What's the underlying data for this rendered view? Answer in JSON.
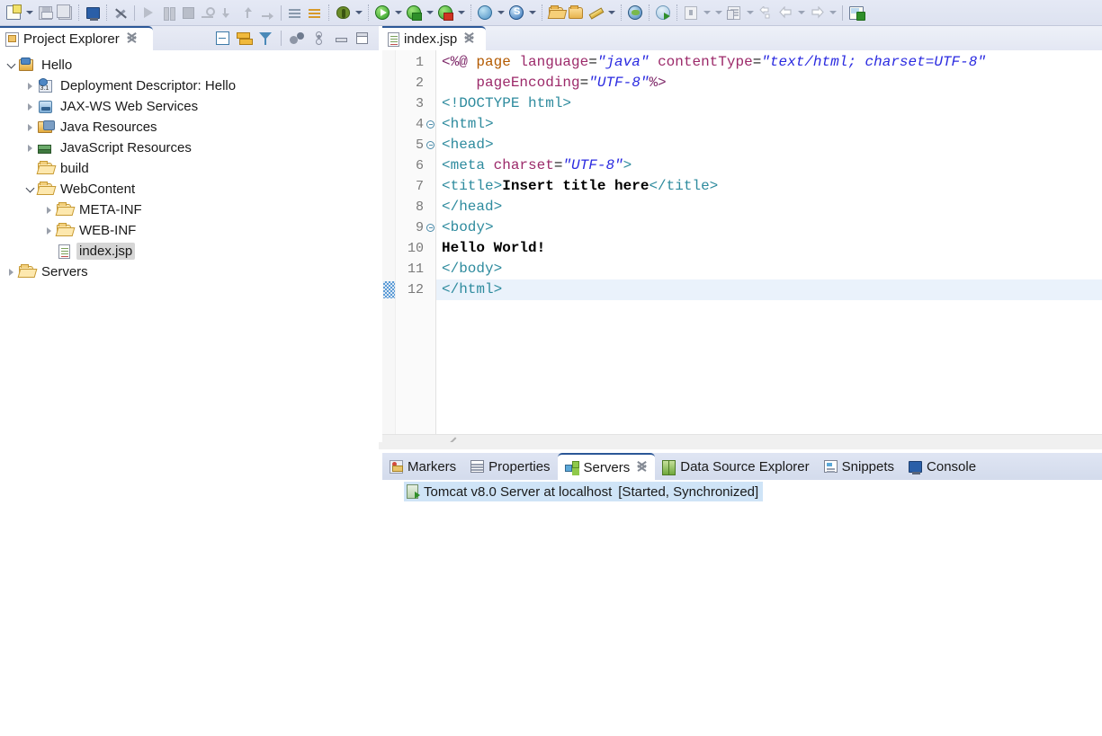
{
  "toolbar": {
    "items": [
      {
        "name": "new-wizard-icon",
        "label": "New"
      },
      {
        "name": "new-dropdown-arrow",
        "label": "New menu"
      },
      {
        "name": "save-icon",
        "label": "Save"
      },
      {
        "name": "save-all-icon",
        "label": "Save All"
      },
      {
        "name": "open-console-icon",
        "label": "Open Console"
      },
      {
        "name": "toggle-breakpoint-icon",
        "label": "Skip All Breakpoints"
      },
      {
        "name": "resume-icon",
        "label": "Resume"
      },
      {
        "name": "suspend-icon",
        "label": "Suspend"
      },
      {
        "name": "terminate-icon",
        "label": "Terminate"
      },
      {
        "name": "disconnect-icon",
        "label": "Disconnect"
      },
      {
        "name": "step-into-icon",
        "label": "Step Into"
      },
      {
        "name": "step-over-icon",
        "label": "Step Over"
      },
      {
        "name": "step-return-icon",
        "label": "Step Return"
      },
      {
        "name": "next-annotation-icon",
        "label": "Next Annotation"
      },
      {
        "name": "previous-annotation-icon",
        "label": "Previous Annotation"
      },
      {
        "name": "debug-icon",
        "label": "Debug"
      },
      {
        "name": "debug-dropdown-arrow",
        "label": "Debug menu"
      },
      {
        "name": "run-icon",
        "label": "Run"
      },
      {
        "name": "run-dropdown-arrow",
        "label": "Run menu"
      },
      {
        "name": "run-on-server-icon",
        "label": "Run on Server"
      },
      {
        "name": "run-server-dropdown-arrow",
        "label": "Run on Server menu"
      },
      {
        "name": "profile-server-icon",
        "label": "Profile on Server"
      },
      {
        "name": "profile-dropdown-arrow",
        "label": "Profile menu"
      },
      {
        "name": "new-web-project-icon",
        "label": "New Web Project"
      },
      {
        "name": "web-dropdown-arrow",
        "label": "Web menu"
      },
      {
        "name": "new-struts-icon",
        "label": "New Struts Artifact"
      },
      {
        "name": "struts-dropdown-arrow",
        "label": "Struts menu"
      },
      {
        "name": "open-type-icon",
        "label": "Open Type"
      },
      {
        "name": "open-task-icon",
        "label": "Open Task"
      },
      {
        "name": "new-java-package-icon",
        "label": "New Java Package"
      },
      {
        "name": "java-dropdown-arrow",
        "label": "Java menu"
      },
      {
        "name": "open-web-browser-icon",
        "label": "Web Browser"
      },
      {
        "name": "search-icon",
        "label": "Search"
      },
      {
        "name": "download-icon",
        "label": "Download"
      },
      {
        "name": "download-dropdown-arrow",
        "label": "Download menu"
      },
      {
        "name": "perspective-dropdown-arrow",
        "label": "Perspective menu"
      },
      {
        "name": "back-icon",
        "label": "Back"
      },
      {
        "name": "back-dropdown-arrow",
        "label": "Back menu"
      },
      {
        "name": "previous-edit-icon",
        "label": "Previous Edit Location"
      },
      {
        "name": "forward-icon",
        "label": "Forward"
      },
      {
        "name": "forward-dropdown-arrow",
        "label": "Forward menu"
      },
      {
        "name": "open-perspective-icon",
        "label": "Open Perspective"
      }
    ]
  },
  "project_explorer": {
    "title": "Project Explorer",
    "view_toolbar": [
      {
        "name": "collapse-all-icon",
        "label": "Collapse All"
      },
      {
        "name": "link-with-editor-icon",
        "label": "Link with Editor"
      },
      {
        "name": "filter-icon",
        "label": "Filters"
      },
      {
        "name": "customize-icon",
        "label": "Customize View"
      },
      {
        "name": "view-menu-icon",
        "label": "View Menu"
      },
      {
        "name": "minimize-icon",
        "label": "Minimize"
      },
      {
        "name": "maximize-icon",
        "label": "Maximize"
      }
    ],
    "tree": [
      {
        "label": "Hello",
        "indent": 0,
        "twisty": "down",
        "icon": "project-icon",
        "selected": false
      },
      {
        "label": "Deployment Descriptor: Hello",
        "indent": 1,
        "twisty": "right",
        "icon": "deployment-descriptor-icon",
        "selected": false
      },
      {
        "label": "JAX-WS Web Services",
        "indent": 1,
        "twisty": "right",
        "icon": "web-services-icon",
        "selected": false
      },
      {
        "label": "Java Resources",
        "indent": 1,
        "twisty": "right",
        "icon": "java-resources-icon",
        "selected": false
      },
      {
        "label": "JavaScript Resources",
        "indent": 1,
        "twisty": "right",
        "icon": "javascript-resources-icon",
        "selected": false
      },
      {
        "label": "build",
        "indent": 1,
        "twisty": "none",
        "icon": "folder-icon",
        "selected": false
      },
      {
        "label": "WebContent",
        "indent": 1,
        "twisty": "down",
        "icon": "folder-icon",
        "selected": false
      },
      {
        "label": "META-INF",
        "indent": 2,
        "twisty": "right",
        "icon": "folder-icon",
        "selected": false
      },
      {
        "label": "WEB-INF",
        "indent": 2,
        "twisty": "right",
        "icon": "folder-icon",
        "selected": false
      },
      {
        "label": "index.jsp",
        "indent": 2,
        "twisty": "none",
        "icon": "jsp-file-icon",
        "selected": true
      },
      {
        "label": "Servers",
        "indent": 0,
        "twisty": "right",
        "icon": "folder-icon",
        "selected": false
      }
    ]
  },
  "editor": {
    "tab_label": "index.jsp",
    "tab_icon": "jsp-file-icon",
    "current_line": 12,
    "lines": [
      {
        "num": "1",
        "fold": false,
        "tokens": [
          {
            "t": "<%@ ",
            "c": "t-jsp"
          },
          {
            "t": "page ",
            "c": "t-kw"
          },
          {
            "t": "language",
            "c": "t-attr"
          },
          {
            "t": "=",
            "c": "t-eq"
          },
          {
            "t": "\"java\"",
            "c": "t-val"
          },
          {
            "t": " ",
            "c": "t-eq"
          },
          {
            "t": "contentType",
            "c": "t-attr"
          },
          {
            "t": "=",
            "c": "t-eq"
          },
          {
            "t": "\"text/html; charset=UTF-8\"",
            "c": "t-val"
          }
        ]
      },
      {
        "num": "2",
        "fold": false,
        "tokens": [
          {
            "t": "    ",
            "c": "t-eq"
          },
          {
            "t": "pageEncoding",
            "c": "t-attr"
          },
          {
            "t": "=",
            "c": "t-eq"
          },
          {
            "t": "\"UTF-8\"",
            "c": "t-val"
          },
          {
            "t": "%>",
            "c": "t-jsp"
          }
        ]
      },
      {
        "num": "3",
        "fold": false,
        "tokens": [
          {
            "t": "<!DOCTYPE html>",
            "c": "t-doct"
          }
        ]
      },
      {
        "num": "4",
        "fold": true,
        "tokens": [
          {
            "t": "<html>",
            "c": "t-tag"
          }
        ]
      },
      {
        "num": "5",
        "fold": true,
        "tokens": [
          {
            "t": "<head>",
            "c": "t-tag"
          }
        ]
      },
      {
        "num": "6",
        "fold": false,
        "tokens": [
          {
            "t": "<meta ",
            "c": "t-tag"
          },
          {
            "t": "charset",
            "c": "t-attr"
          },
          {
            "t": "=",
            "c": "t-eq"
          },
          {
            "t": "\"UTF-8\"",
            "c": "t-val"
          },
          {
            "t": ">",
            "c": "t-tag"
          }
        ]
      },
      {
        "num": "7",
        "fold": false,
        "tokens": [
          {
            "t": "<title>",
            "c": "t-tag"
          },
          {
            "t": "Insert title here",
            "c": "t-txt"
          },
          {
            "t": "</title>",
            "c": "t-tag"
          }
        ]
      },
      {
        "num": "8",
        "fold": false,
        "tokens": [
          {
            "t": "</head>",
            "c": "t-tag"
          }
        ]
      },
      {
        "num": "9",
        "fold": true,
        "tokens": [
          {
            "t": "<body>",
            "c": "t-tag"
          }
        ]
      },
      {
        "num": "10",
        "fold": false,
        "tokens": [
          {
            "t": "Hello World!",
            "c": "t-txt"
          }
        ]
      },
      {
        "num": "11",
        "fold": false,
        "tokens": [
          {
            "t": "</body>",
            "c": "t-tag"
          }
        ]
      },
      {
        "num": "12",
        "fold": false,
        "tokens": [
          {
            "t": "</html>",
            "c": "t-tag"
          }
        ]
      }
    ]
  },
  "bottom_panel": {
    "tabs": [
      {
        "label": "Markers",
        "icon": "markers-icon",
        "active": false,
        "closable": false
      },
      {
        "label": "Properties",
        "icon": "properties-icon",
        "active": false,
        "closable": false
      },
      {
        "label": "Servers",
        "icon": "servers-icon",
        "active": true,
        "closable": true
      },
      {
        "label": "Data Source Explorer",
        "icon": "data-source-explorer-icon",
        "active": false,
        "closable": false
      },
      {
        "label": "Snippets",
        "icon": "snippets-icon",
        "active": false,
        "closable": false
      },
      {
        "label": "Console",
        "icon": "console-icon",
        "active": false,
        "closable": false
      }
    ],
    "servers": [
      {
        "name": "Tomcat v8.0 Server at localhost",
        "state": "[Started, Synchronized]",
        "icon": "server-started-icon",
        "selected": true
      }
    ]
  },
  "colors": {
    "accent": "#2b5797",
    "selection": "#cfe4f7",
    "tree_selection": "#d6d6d6",
    "current_line": "#eaf2fb",
    "toolbar_bg": "#e5e9f5"
  }
}
